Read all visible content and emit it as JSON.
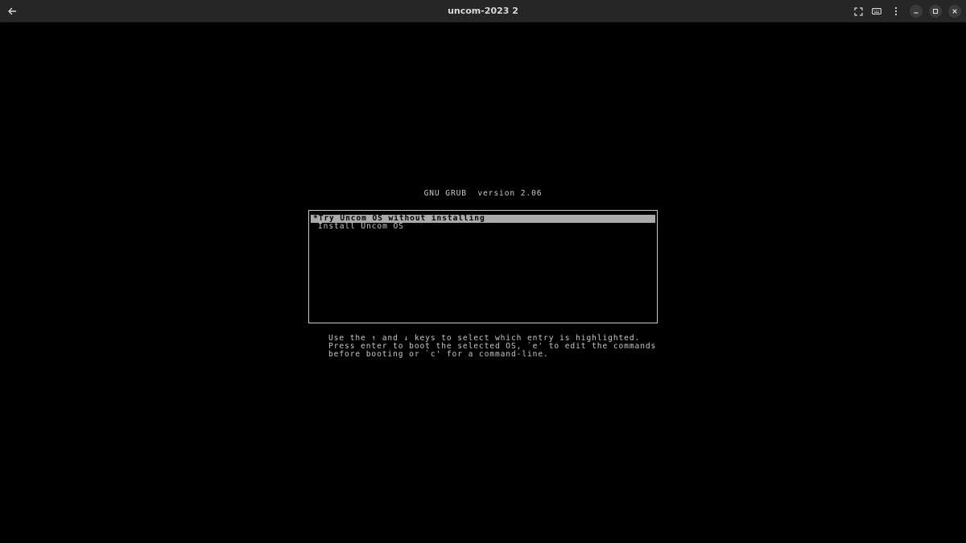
{
  "window": {
    "title": "uncom-2023 2",
    "icons": {
      "back": "arrow-left-icon",
      "fullscreen": "fullscreen-icon",
      "keyboard": "keyboard-icon",
      "menu": "kebab-menu-icon",
      "minimize": "minimize-icon",
      "maximize": "maximize-icon",
      "close": "close-icon"
    }
  },
  "grub": {
    "header": "GNU GRUB  version 2.06",
    "selection_marker": "*",
    "entries": [
      {
        "label": "Try Uncom OS without installing",
        "selected": true
      },
      {
        "label": "Install Uncom OS",
        "selected": false
      }
    ],
    "help": [
      "Use the ↑ and ↓ keys to select which entry is highlighted.",
      "Press enter to boot the selected OS, `e' to edit the commands",
      "before booting or `c' for a command-line."
    ]
  },
  "colors": {
    "titlebar_bg": "#262626",
    "screen_bg": "#000000",
    "grub_text": "#c8c8c8",
    "grub_highlight": "#aaaaaa"
  }
}
